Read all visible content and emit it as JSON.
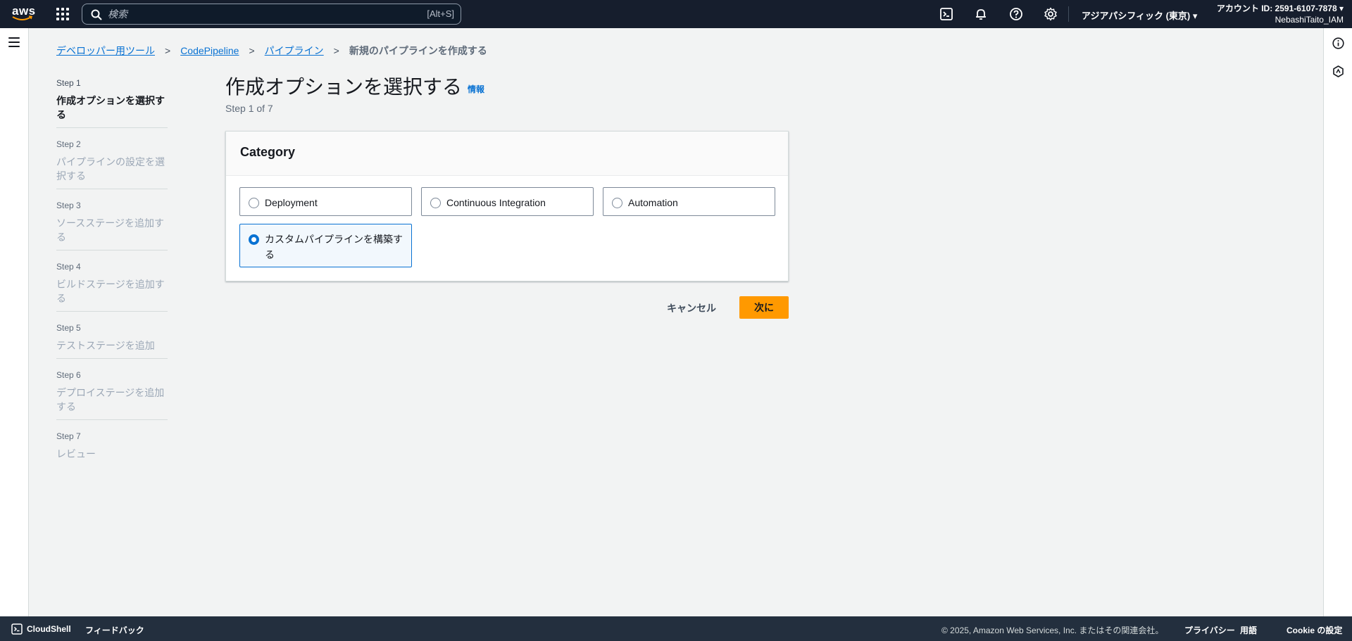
{
  "topnav": {
    "logo_text": "aws",
    "search_placeholder": "検索",
    "search_shortcut": "[Alt+S]",
    "region": "アジアパシフィック (東京) ▾",
    "account_id": "アカウント ID: 2591-6107-7878 ▾",
    "account_user": "NebashiTaito_IAM"
  },
  "breadcrumb": {
    "items": [
      "デベロッパー用ツール",
      "CodePipeline",
      "パイプライン"
    ],
    "current": "新規のパイプラインを作成する"
  },
  "steps": [
    {
      "num": "Step 1",
      "label": "作成オプションを選択する"
    },
    {
      "num": "Step 2",
      "label": "パイプラインの設定を選択する"
    },
    {
      "num": "Step 3",
      "label": "ソースステージを追加する"
    },
    {
      "num": "Step 4",
      "label": "ビルドステージを追加する"
    },
    {
      "num": "Step 5",
      "label": "テストステージを追加"
    },
    {
      "num": "Step 6",
      "label": "デプロイステージを追加する"
    },
    {
      "num": "Step 7",
      "label": "レビュー"
    }
  ],
  "main": {
    "title": "作成オプションを選択する",
    "info": "情報",
    "step_count": "Step 1 of 7",
    "panel_title": "Category",
    "options": [
      "Deployment",
      "Continuous Integration",
      "Automation",
      "カスタムパイプラインを構築する"
    ],
    "selected_option": "カスタムパイプラインを構築する",
    "cancel_label": "キャンセル",
    "next_label": "次に"
  },
  "footer": {
    "cloudshell": "CloudShell",
    "feedback": "フィードバック",
    "copyright": "© 2025, Amazon Web Services, Inc. またはその関連会社。",
    "privacy": "プライバシー",
    "terms": "用語",
    "cookie": "Cookie の設定"
  },
  "colors": {
    "nav_bg": "#161e2d",
    "accent_blue": "#0972d3",
    "primary_orange": "#ff9900",
    "footer_bg": "#232f3e"
  }
}
